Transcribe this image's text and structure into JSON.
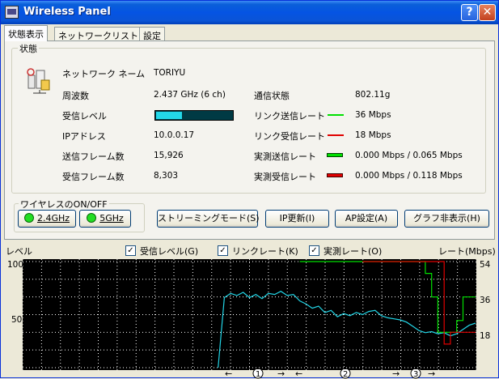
{
  "window": {
    "title": "Wireless Panel",
    "help_label": "?",
    "close_label": "✕",
    "icon": "wireless-panel-icon"
  },
  "tabs": [
    {
      "label": "状態表示",
      "active": true
    },
    {
      "label": "ネットワークリスト",
      "active": false
    },
    {
      "label": "設定",
      "active": false
    }
  ],
  "status": {
    "group_label": "状態",
    "icon": "wireless-network-icon",
    "network_name_label": "ネットワーク ネーム",
    "network_name": "TORIYU",
    "frequency_label": "周波数",
    "frequency": "2.437 GHz (6 ch)",
    "rx_level_label": "受信レベル",
    "rx_level_fraction": 0.33,
    "ip_label": "IPアドレス",
    "ip": "10.0.0.17",
    "tx_frames_label": "送信フレーム数",
    "tx_frames": "15,926",
    "rx_frames_label": "受信フレーム数",
    "rx_frames": "8,303",
    "comm_state_label": "通信状態",
    "comm_state": "802.11g",
    "link_tx_label": "リンク送信レート",
    "link_tx": "36 Mbps",
    "link_rx_label": "リンク受信レート",
    "link_rx": "18 Mbps",
    "meas_tx_label": "実測送信レート",
    "meas_tx": "0.000 Mbps / 0.065 Mbps",
    "meas_rx_label": "実測受信レート",
    "meas_rx": "0.000 Mbps / 0.118 Mbps",
    "colors": {
      "link_tx": "#00e000",
      "link_rx": "#e00000",
      "meas_tx": "#007a00",
      "meas_rx": "#a00000",
      "level": "#23d7e8"
    }
  },
  "wireless": {
    "group_label": "ワイヤレスのON/OFF",
    "btn_24": "2.4GHz",
    "btn_5": "5GHz"
  },
  "buttons": {
    "streaming": "ストリーミングモード(S)",
    "ip_update": "IP更新(I)",
    "ap_settings": "AP設定(A)",
    "hide_graph": "グラフ非表示(H)"
  },
  "graph": {
    "left_title": "レベル",
    "right_title": "レート(Mbps)",
    "cb_level": "受信レベル(G)",
    "cb_link": "リンクレート(K)",
    "cb_meas": "実測レート(O)",
    "cb_level_checked": true,
    "cb_link_checked": true,
    "cb_meas_checked": true,
    "left_ticks": [
      "100",
      "50"
    ],
    "right_ticks": [
      "54",
      "36",
      "18"
    ],
    "markers": [
      "1",
      "2",
      "3"
    ],
    "arrows": {
      "left": "←",
      "right": "→"
    }
  },
  "chart_data": {
    "type": "line",
    "x": [
      0,
      1,
      2,
      3,
      4,
      5,
      6,
      7,
      8,
      9,
      10,
      11,
      12,
      13,
      14,
      15,
      16,
      17,
      18,
      19,
      20,
      21,
      22,
      23,
      24,
      25,
      26,
      27,
      28,
      29,
      30,
      31,
      32,
      33,
      34,
      35,
      36,
      37,
      38,
      39,
      40,
      41,
      42,
      43,
      44,
      45,
      46,
      47,
      48,
      49,
      50,
      51,
      52,
      53,
      54,
      55,
      56,
      57,
      58,
      59,
      60,
      61,
      62,
      63,
      64,
      65,
      66,
      67,
      68,
      69,
      70,
      71,
      72
    ],
    "series": [
      {
        "values": [
          null,
          null,
          null,
          null,
          null,
          null,
          null,
          null,
          null,
          null,
          null,
          null,
          null,
          null,
          null,
          null,
          null,
          null,
          null,
          null,
          null,
          null,
          null,
          null,
          null,
          null,
          null,
          null,
          null,
          null,
          null,
          0,
          66,
          70,
          68,
          71,
          66,
          69,
          65,
          70,
          69,
          72,
          68,
          69,
          63,
          60,
          56,
          58,
          52,
          54,
          48,
          51,
          49,
          52,
          50,
          53,
          54,
          49,
          47,
          46,
          45,
          43,
          39,
          35,
          33,
          34,
          32,
          33,
          30,
          32,
          36,
          40,
          42
        ]
      },
      {
        "values": [
          null,
          null,
          null,
          null,
          null,
          null,
          null,
          null,
          null,
          null,
          null,
          null,
          null,
          null,
          null,
          null,
          null,
          null,
          null,
          null,
          null,
          null,
          null,
          null,
          null,
          null,
          null,
          null,
          null,
          null,
          null,
          null,
          null,
          null,
          null,
          null,
          null,
          null,
          null,
          null,
          null,
          null,
          null,
          null,
          54,
          54,
          54,
          54,
          54,
          54,
          54,
          54,
          54,
          54,
          54,
          54,
          54,
          54,
          54,
          54,
          54,
          54,
          54,
          54,
          48,
          36,
          18,
          18,
          18,
          24,
          36,
          36,
          36
        ]
      },
      {
        "values": [
          null,
          null,
          null,
          null,
          null,
          null,
          null,
          null,
          null,
          null,
          null,
          null,
          null,
          null,
          null,
          null,
          null,
          null,
          null,
          null,
          null,
          null,
          null,
          null,
          null,
          null,
          null,
          null,
          null,
          null,
          null,
          null,
          null,
          null,
          null,
          null,
          null,
          null,
          null,
          null,
          null,
          null,
          null,
          null,
          null,
          null,
          null,
          null,
          null,
          null,
          null,
          null,
          null,
          null,
          54,
          54,
          54,
          54,
          54,
          54,
          54,
          54,
          54,
          54,
          54,
          54,
          54,
          12,
          18,
          18,
          18,
          18,
          18
        ]
      }
    ],
    "ylim_left": [
      0,
      100
    ],
    "ylim_right": [
      0,
      54
    ],
    "grid": true
  }
}
